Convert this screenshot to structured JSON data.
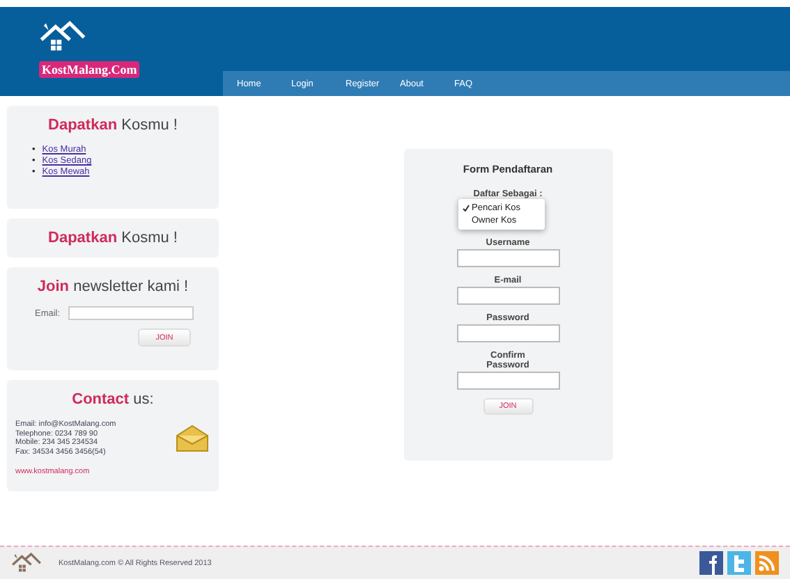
{
  "header": {
    "logo_text": "KostMalang.Com"
  },
  "nav": [
    {
      "label": "Home"
    },
    {
      "label": "Login"
    },
    {
      "label": "Register"
    },
    {
      "label": "About"
    },
    {
      "label": "FAQ"
    }
  ],
  "sidebar": {
    "kos_panel": {
      "title_accent": "Dapatkan",
      "title_rest": "Kosmu !",
      "bullet": "•",
      "links": [
        "Kos Murah",
        "Kos Sedang",
        "Kos Mewah"
      ]
    },
    "kos_panel_2": {
      "title_accent": "Dapatkan",
      "title_rest": "Kosmu !"
    },
    "newsletter": {
      "title_accent": "Join",
      "title_rest": "newsletter kami !",
      "email_label": "Email:",
      "button": "JOIN"
    },
    "contact": {
      "title_accent": "Contact",
      "title_rest": "us:",
      "lines": [
        "Email: info@KostMalang.com",
        "Telephone: 0234 789 90",
        "Mobile: 234 345 234534",
        "Fax: 34534 3456 3456(54)"
      ],
      "website": "www.kostmalang.com"
    }
  },
  "form": {
    "title": "Form Pendaftaran",
    "role_label": "Daftar Sebagai :",
    "role_options": [
      {
        "label": "Pencari Kos",
        "selected": true
      },
      {
        "label": "Owner Kos",
        "selected": false
      }
    ],
    "fields": [
      {
        "label": "Username"
      },
      {
        "label": "E-mail"
      },
      {
        "label": "Password"
      },
      {
        "label": "Confirm Password"
      }
    ],
    "button": "JOIN"
  },
  "footer": {
    "copyright": "KostMalang.com © All Rights Reserved 2013"
  }
}
